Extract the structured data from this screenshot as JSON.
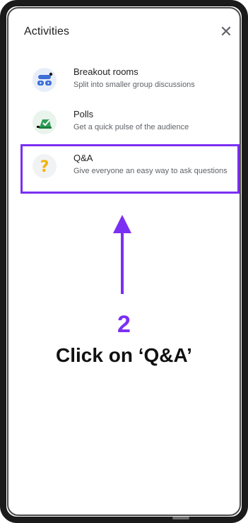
{
  "header": {
    "title": "Activities",
    "close_icon": "close-icon"
  },
  "activities": [
    {
      "title": "Breakout rooms",
      "description": "Split into smaller group discussions",
      "icon": "breakout-rooms-icon"
    },
    {
      "title": "Polls",
      "description": "Get a quick pulse of the audience",
      "icon": "polls-icon"
    },
    {
      "title": "Q&A",
      "description": "Give everyone an easy way to ask questions",
      "icon": "qa-icon"
    }
  ],
  "instruction": {
    "step": "2",
    "text": "Click on ‘Q&A’"
  },
  "colors": {
    "accent": "#7b2ff2",
    "text_primary": "#202124",
    "text_secondary": "#5f6368"
  }
}
